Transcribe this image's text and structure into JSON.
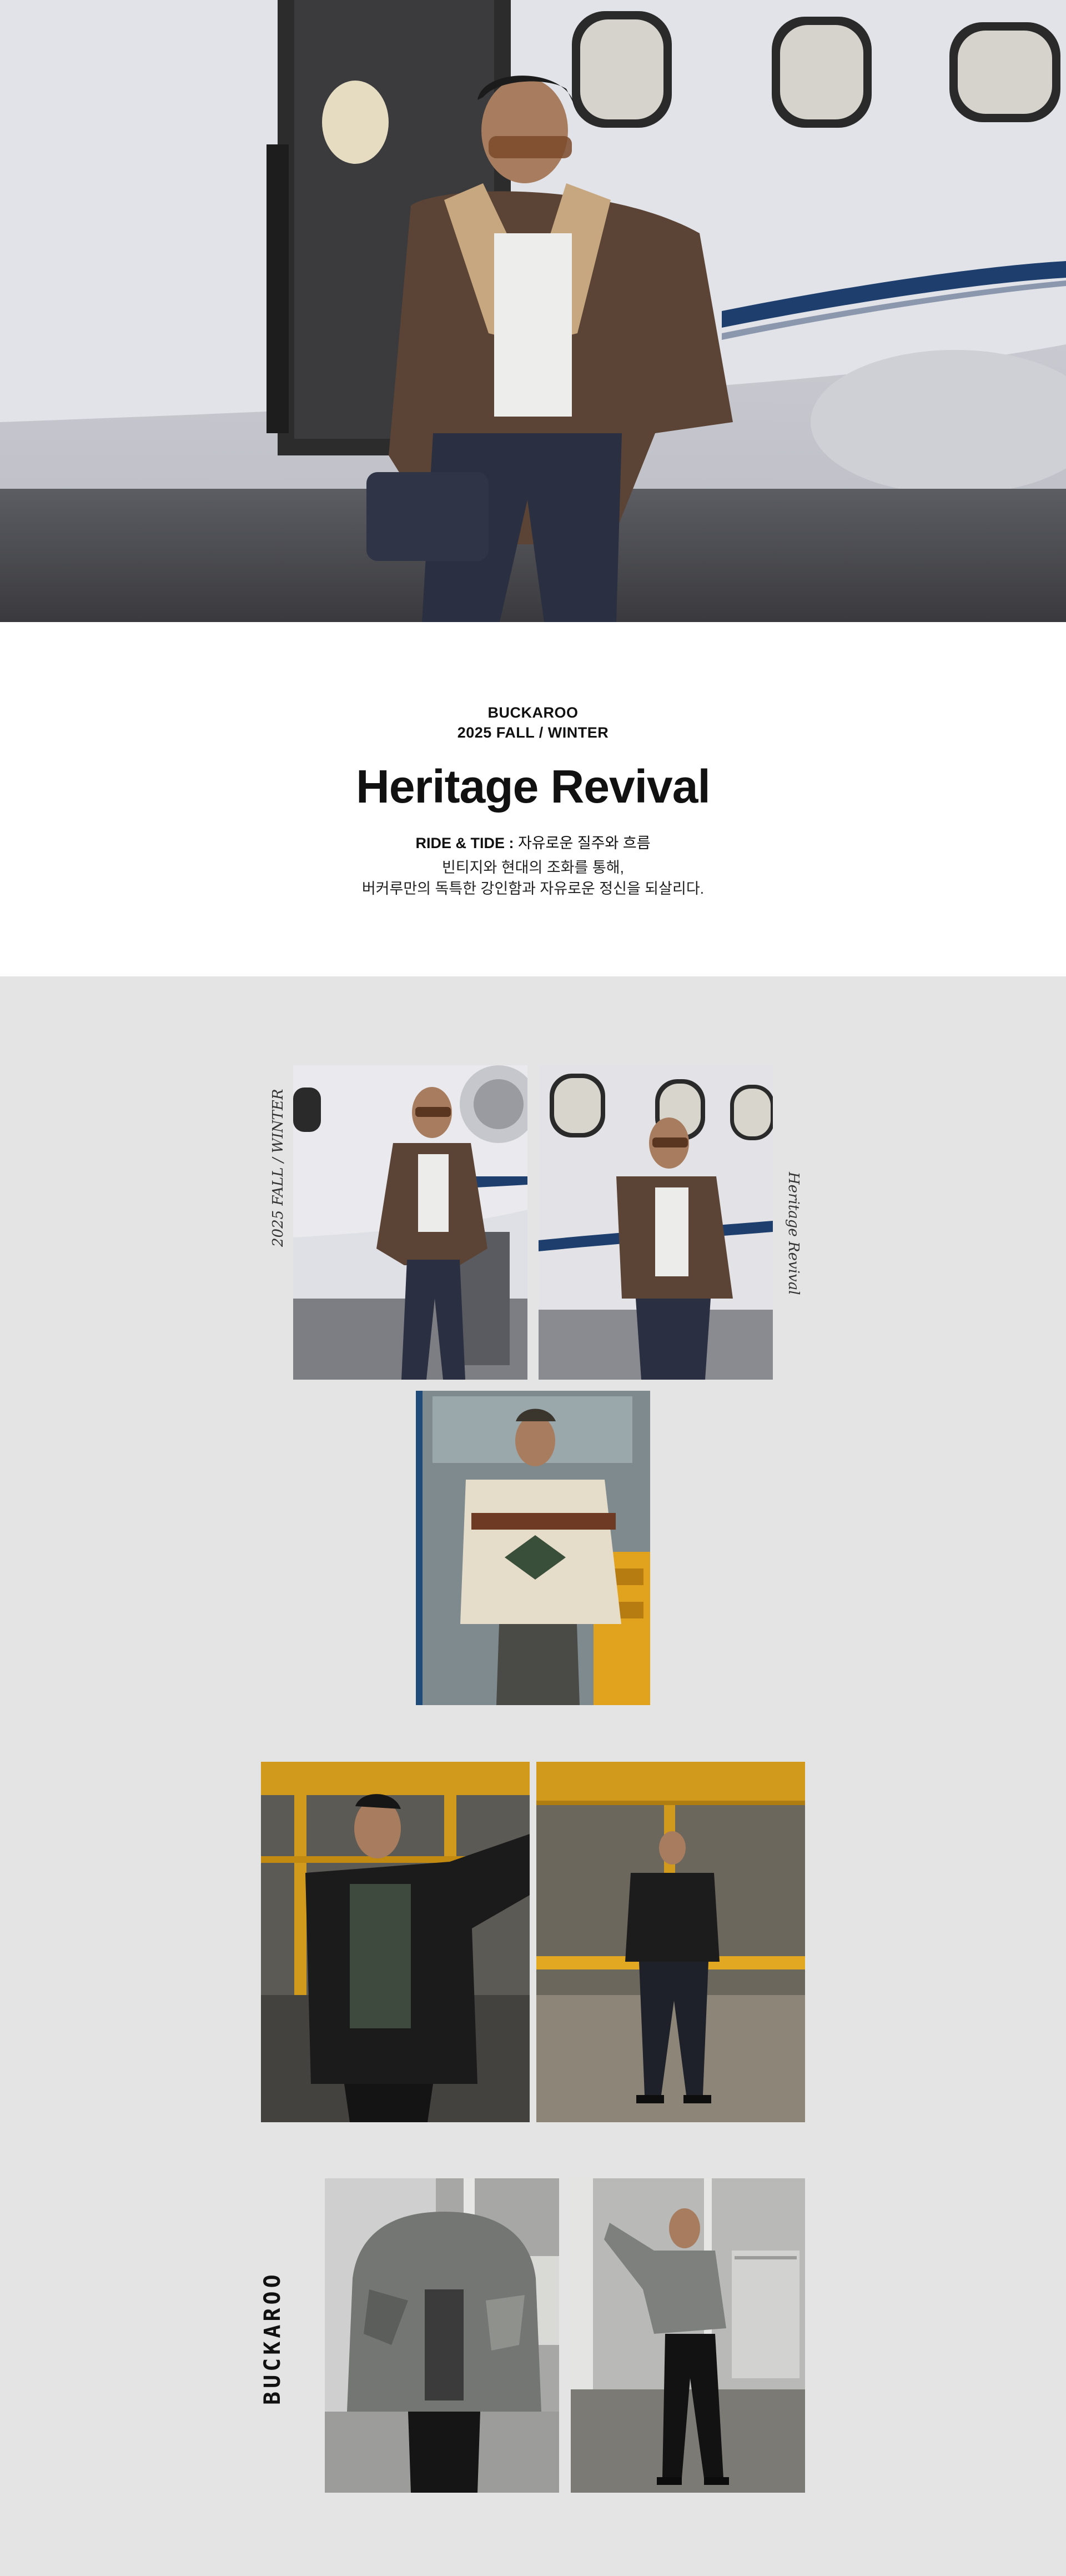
{
  "hero": {
    "image": "hero-photo-man-by-private-jet-shearling-jacket"
  },
  "intro": {
    "brand": "BUCKAROO",
    "season": "2025 FALL / WINTER",
    "title": "Heritage Revival",
    "tagline_bold": "RIDE & TIDE :",
    "tagline_rest": " 자유로운 질주와 흐름",
    "description_line1": "빈티지와 현대의 조화를 통해,",
    "description_line2": "버커루만의 독특한 강인함과 자유로운 정신을 되살리다."
  },
  "lookbook": {
    "side_text_left": "2025 FALL / WINTER",
    "side_text_right": "Heritage Revival",
    "side_brand": "BUCKAROO",
    "photos": [
      "look-1-shearling-jacket-jet",
      "look-2-shearling-jacket-jet-lean",
      "look-3-nordic-knit-cardigan",
      "look-4-black-puffer-hangar",
      "look-5-black-puffer-full-body",
      "look-6-camo-puffer-hood",
      "look-7-camo-puffer-full-body"
    ]
  },
  "colors": {
    "intro_bg": "#ffffff",
    "lookbook_bg": "#e4e4e4",
    "text": "#111111"
  }
}
